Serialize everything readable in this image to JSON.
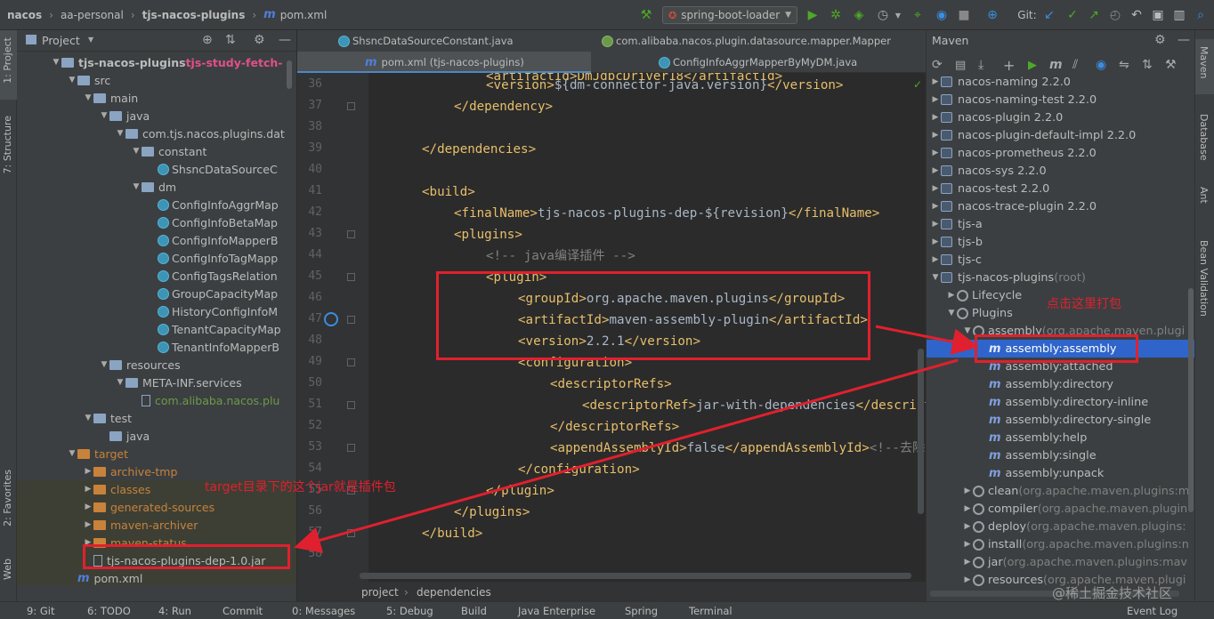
{
  "topbar": {
    "breadcrumbs": [
      "nacos",
      "aa-personal",
      "tjs-nacos-plugins",
      "pom.xml"
    ],
    "run_config": "spring-boot-loader",
    "git_label": "Git:"
  },
  "left_strip": {
    "tabs": [
      "1: Project",
      "7: Structure",
      "2: Favorites",
      "Web"
    ]
  },
  "project": {
    "header": "Project",
    "tree": [
      {
        "label": "tjs-nacos-plugins",
        "extra": "tjs-study-fetch-",
        "indent": 0,
        "arrow": "down",
        "icon": "folder"
      },
      {
        "label": "src",
        "indent": 1,
        "arrow": "down",
        "icon": "folder"
      },
      {
        "label": "main",
        "indent": 2,
        "arrow": "down",
        "icon": "folder"
      },
      {
        "label": "java",
        "indent": 3,
        "arrow": "down",
        "icon": "folder"
      },
      {
        "label": "com.tjs.nacos.plugins.dat",
        "indent": 4,
        "arrow": "down",
        "icon": "folder"
      },
      {
        "label": "constant",
        "indent": 5,
        "arrow": "down",
        "icon": "folder"
      },
      {
        "label": "ShsncDataSourceC",
        "indent": 6,
        "arrow": "",
        "icon": "class"
      },
      {
        "label": "dm",
        "indent": 5,
        "arrow": "down",
        "icon": "folder"
      },
      {
        "label": "ConfigInfoAggrMap",
        "indent": 6,
        "arrow": "",
        "icon": "class"
      },
      {
        "label": "ConfigInfoBetaMap",
        "indent": 6,
        "arrow": "",
        "icon": "class"
      },
      {
        "label": "ConfigInfoMapperB",
        "indent": 6,
        "arrow": "",
        "icon": "class"
      },
      {
        "label": "ConfigInfoTagMapp",
        "indent": 6,
        "arrow": "",
        "icon": "class"
      },
      {
        "label": "ConfigTagsRelation",
        "indent": 6,
        "arrow": "",
        "icon": "class"
      },
      {
        "label": "GroupCapacityMap",
        "indent": 6,
        "arrow": "",
        "icon": "class"
      },
      {
        "label": "HistoryConfigInfoM",
        "indent": 6,
        "arrow": "",
        "icon": "class"
      },
      {
        "label": "TenantCapacityMap",
        "indent": 6,
        "arrow": "",
        "icon": "class"
      },
      {
        "label": "TenantInfoMapperB",
        "indent": 6,
        "arrow": "",
        "icon": "class"
      },
      {
        "label": "resources",
        "indent": 3,
        "arrow": "down",
        "icon": "folder"
      },
      {
        "label": "META-INF.services",
        "indent": 4,
        "arrow": "down",
        "icon": "folder"
      },
      {
        "label": "com.alibaba.nacos.plu",
        "indent": 5,
        "arrow": "",
        "icon": "file"
      },
      {
        "label": "test",
        "indent": 2,
        "arrow": "down",
        "icon": "folder"
      },
      {
        "label": "java",
        "indent": 3,
        "arrow": "",
        "icon": "folder"
      },
      {
        "label": "target",
        "indent": 1,
        "arrow": "down",
        "icon": "folder-orange"
      },
      {
        "label": "archive-tmp",
        "indent": 2,
        "arrow": "right",
        "icon": "folder-orange"
      },
      {
        "label": "classes",
        "indent": 2,
        "arrow": "right",
        "icon": "folder-orange"
      },
      {
        "label": "generated-sources",
        "indent": 2,
        "arrow": "right",
        "icon": "folder-orange"
      },
      {
        "label": "maven-archiver",
        "indent": 2,
        "arrow": "right",
        "icon": "folder-orange"
      },
      {
        "label": "maven-status",
        "indent": 2,
        "arrow": "right",
        "icon": "folder-orange"
      },
      {
        "label": "tjs-nacos-plugins-dep-1.0.jar",
        "indent": 2,
        "arrow": "",
        "icon": "jar"
      },
      {
        "label": "pom.xml",
        "indent": 1,
        "arrow": "",
        "icon": "maven"
      }
    ]
  },
  "editor": {
    "tabs_row1": [
      "ShsncDataSourceConstant.java",
      "com.alibaba.nacos.plugin.datasource.mapper.Mapper"
    ],
    "tabs_row2": [
      "pom.xml (tjs-nacos-plugins)",
      "ConfigInfoAggrMapperByMyDM.java"
    ],
    "lines": [
      {
        "n": "36",
        "indent": 3,
        "tag": "<version>",
        "text": "${dm-connector-java.version}",
        "close": "</version>"
      },
      {
        "n": "37",
        "indent": 2,
        "tag": "</dependency>",
        "text": "",
        "close": ""
      },
      {
        "n": "38",
        "indent": 0,
        "tag": "",
        "text": "",
        "close": ""
      },
      {
        "n": "39",
        "indent": 1,
        "tag": "</dependencies>",
        "text": "",
        "close": ""
      },
      {
        "n": "40",
        "indent": 0,
        "tag": "",
        "text": "",
        "close": ""
      },
      {
        "n": "41",
        "indent": 1,
        "tag": "<build>",
        "text": "",
        "close": ""
      },
      {
        "n": "42",
        "indent": 2,
        "tag": "<finalName>",
        "text": "tjs-nacos-plugins-dep-${revision}",
        "close": "</finalName>"
      },
      {
        "n": "43",
        "indent": 2,
        "tag": "<plugins>",
        "text": "",
        "close": ""
      },
      {
        "n": "44",
        "indent": 3,
        "tag": "",
        "text": "",
        "close": "",
        "comment": "<!-- java编译插件 -->"
      },
      {
        "n": "45",
        "indent": 3,
        "tag": "<plugin>",
        "text": "",
        "close": ""
      },
      {
        "n": "46",
        "indent": 4,
        "tag": "<groupId>",
        "text": "org.apache.maven.plugins",
        "close": "</groupId>"
      },
      {
        "n": "47",
        "indent": 4,
        "tag": "<artifactId>",
        "text": "maven-assembly-plugin",
        "close": "</artifactId>"
      },
      {
        "n": "48",
        "indent": 4,
        "tag": "<version>",
        "text": "2.2.1",
        "close": "</version>"
      },
      {
        "n": "49",
        "indent": 4,
        "tag": "<configuration>",
        "text": "",
        "close": ""
      },
      {
        "n": "50",
        "indent": 5,
        "tag": "<descriptorRefs>",
        "text": "",
        "close": ""
      },
      {
        "n": "51",
        "indent": 6,
        "tag": "<descriptorRef>",
        "text": "jar-with-dependencies",
        "close": "</descripto"
      },
      {
        "n": "52",
        "indent": 5,
        "tag": "</descriptorRefs>",
        "text": "",
        "close": ""
      },
      {
        "n": "53",
        "indent": 5,
        "tag": "<appendAssemblyId>",
        "text": "false",
        "close": "</appendAssemblyId>",
        "comment": "<!--去除j"
      },
      {
        "n": "54",
        "indent": 4,
        "tag": "</configuration>",
        "text": "",
        "close": ""
      },
      {
        "n": "55",
        "indent": 3,
        "tag": "</plugin>",
        "text": "",
        "close": ""
      },
      {
        "n": "56",
        "indent": 2,
        "tag": "</plugins>",
        "text": "",
        "close": ""
      },
      {
        "n": "57",
        "indent": 1,
        "tag": "</build>",
        "text": "",
        "close": ""
      },
      {
        "n": "58",
        "indent": 0,
        "tag": "",
        "text": "",
        "close": ""
      }
    ],
    "partial_top_line": "<artifactId>DmJdbcDriver18</artifactId>",
    "breadcrumb": [
      "project",
      "dependencies"
    ]
  },
  "maven": {
    "title": "Maven",
    "rows": [
      {
        "label": "nacos-naming 2.2.0",
        "gray": "",
        "indent": 0,
        "arrow": "right",
        "icon": "module"
      },
      {
        "label": "nacos-naming-test 2.2.0",
        "gray": "",
        "indent": 0,
        "arrow": "right",
        "icon": "module"
      },
      {
        "label": "nacos-plugin 2.2.0",
        "gray": "",
        "indent": 0,
        "arrow": "right",
        "icon": "module"
      },
      {
        "label": "nacos-plugin-default-impl 2.2.0",
        "gray": "",
        "indent": 0,
        "arrow": "right",
        "icon": "module"
      },
      {
        "label": "nacos-prometheus 2.2.0",
        "gray": "",
        "indent": 0,
        "arrow": "right",
        "icon": "module"
      },
      {
        "label": "nacos-sys 2.2.0",
        "gray": "",
        "indent": 0,
        "arrow": "right",
        "icon": "module"
      },
      {
        "label": "nacos-test 2.2.0",
        "gray": "",
        "indent": 0,
        "arrow": "right",
        "icon": "module"
      },
      {
        "label": "nacos-trace-plugin 2.2.0",
        "gray": "",
        "indent": 0,
        "arrow": "right",
        "icon": "module"
      },
      {
        "label": "tjs-a",
        "gray": "",
        "indent": 0,
        "arrow": "right",
        "icon": "module"
      },
      {
        "label": "tjs-b",
        "gray": "",
        "indent": 0,
        "arrow": "right",
        "icon": "module"
      },
      {
        "label": "tjs-c",
        "gray": "",
        "indent": 0,
        "arrow": "right",
        "icon": "module"
      },
      {
        "label": "tjs-nacos-plugins",
        "gray": " (root)",
        "indent": 0,
        "arrow": "down",
        "icon": "module"
      },
      {
        "label": "Lifecycle",
        "gray": "",
        "indent": 1,
        "arrow": "right",
        "icon": "gear"
      },
      {
        "label": "Plugins",
        "gray": "",
        "indent": 1,
        "arrow": "down",
        "icon": "gear"
      },
      {
        "label": "assembly",
        "gray": " (org.apache.maven.plugi",
        "indent": 2,
        "arrow": "down",
        "icon": "gear"
      },
      {
        "label": "assembly:assembly",
        "gray": "",
        "indent": 3,
        "arrow": "",
        "icon": "goal",
        "selected": true
      },
      {
        "label": "assembly:attached",
        "gray": "",
        "indent": 3,
        "arrow": "",
        "icon": "goal"
      },
      {
        "label": "assembly:directory",
        "gray": "",
        "indent": 3,
        "arrow": "",
        "icon": "goal"
      },
      {
        "label": "assembly:directory-inline",
        "gray": "",
        "indent": 3,
        "arrow": "",
        "icon": "goal"
      },
      {
        "label": "assembly:directory-single",
        "gray": "",
        "indent": 3,
        "arrow": "",
        "icon": "goal"
      },
      {
        "label": "assembly:help",
        "gray": "",
        "indent": 3,
        "arrow": "",
        "icon": "goal"
      },
      {
        "label": "assembly:single",
        "gray": "",
        "indent": 3,
        "arrow": "",
        "icon": "goal"
      },
      {
        "label": "assembly:unpack",
        "gray": "",
        "indent": 3,
        "arrow": "",
        "icon": "goal"
      },
      {
        "label": "clean",
        "gray": " (org.apache.maven.plugins:m",
        "indent": 2,
        "arrow": "right",
        "icon": "gear"
      },
      {
        "label": "compiler",
        "gray": " (org.apache.maven.plugin",
        "indent": 2,
        "arrow": "right",
        "icon": "gear"
      },
      {
        "label": "deploy",
        "gray": " (org.apache.maven.plugins:",
        "indent": 2,
        "arrow": "right",
        "icon": "gear"
      },
      {
        "label": "install",
        "gray": " (org.apache.maven.plugins:n",
        "indent": 2,
        "arrow": "right",
        "icon": "gear"
      },
      {
        "label": "jar",
        "gray": " (org.apache.maven.plugins:mav",
        "indent": 2,
        "arrow": "right",
        "icon": "gear"
      },
      {
        "label": "resources",
        "gray": " (org.apache.maven.plugi",
        "indent": 2,
        "arrow": "right",
        "icon": "gear"
      }
    ]
  },
  "right_strip": {
    "tabs": [
      "Maven",
      "Database",
      "Ant",
      "Bean Validation"
    ]
  },
  "status_bar": {
    "items": [
      "9: Git",
      "6: TODO",
      "4: Run",
      "Commit",
      "0: Messages",
      "5: Debug",
      "Build",
      "Java Enterprise",
      "Spring",
      "Terminal",
      "Event Log"
    ]
  },
  "annotations": {
    "maven_note": "点击这里打包",
    "target_note": "target目录下的这个jar就是插件包"
  },
  "watermark": "@稀土掘金技术社区",
  "colors": {
    "annotation_red": "#e0202e",
    "selection_blue": "#2f65ca",
    "tag_color": "#e8bf6a",
    "text_color": "#a9b7c6"
  }
}
